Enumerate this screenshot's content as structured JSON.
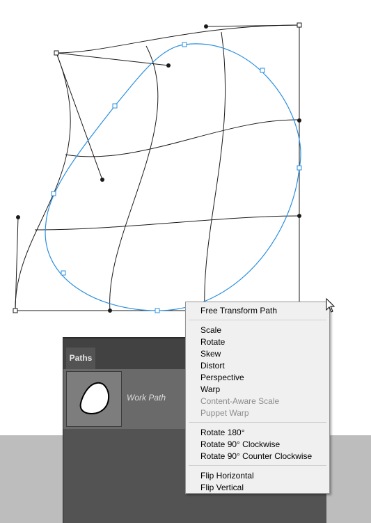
{
  "panel": {
    "tab_label": "Paths",
    "work_path_label": "Work Path",
    "thumb_icon": "blob-shape-icon"
  },
  "menu": {
    "free_transform_path": "Free Transform Path",
    "scale": "Scale",
    "rotate": "Rotate",
    "skew": "Skew",
    "distort": "Distort",
    "perspective": "Perspective",
    "warp": "Warp",
    "content_aware_scale": "Content-Aware Scale",
    "puppet_warp": "Puppet Warp",
    "rotate_180": "Rotate 180°",
    "rotate_90_cw": "Rotate 90° Clockwise",
    "rotate_90_ccw": "Rotate 90° Counter Clockwise",
    "flip_horizontal": "Flip Horizontal",
    "flip_vertical": "Flip Vertical"
  },
  "colors": {
    "path_stroke": "#2a8fe0",
    "grid_stroke": "#1a1a1a",
    "menu_bg": "#f0f0f0",
    "panel_bg": "#535353"
  },
  "icons": {
    "cursor": "arrow-pointer-icon"
  }
}
